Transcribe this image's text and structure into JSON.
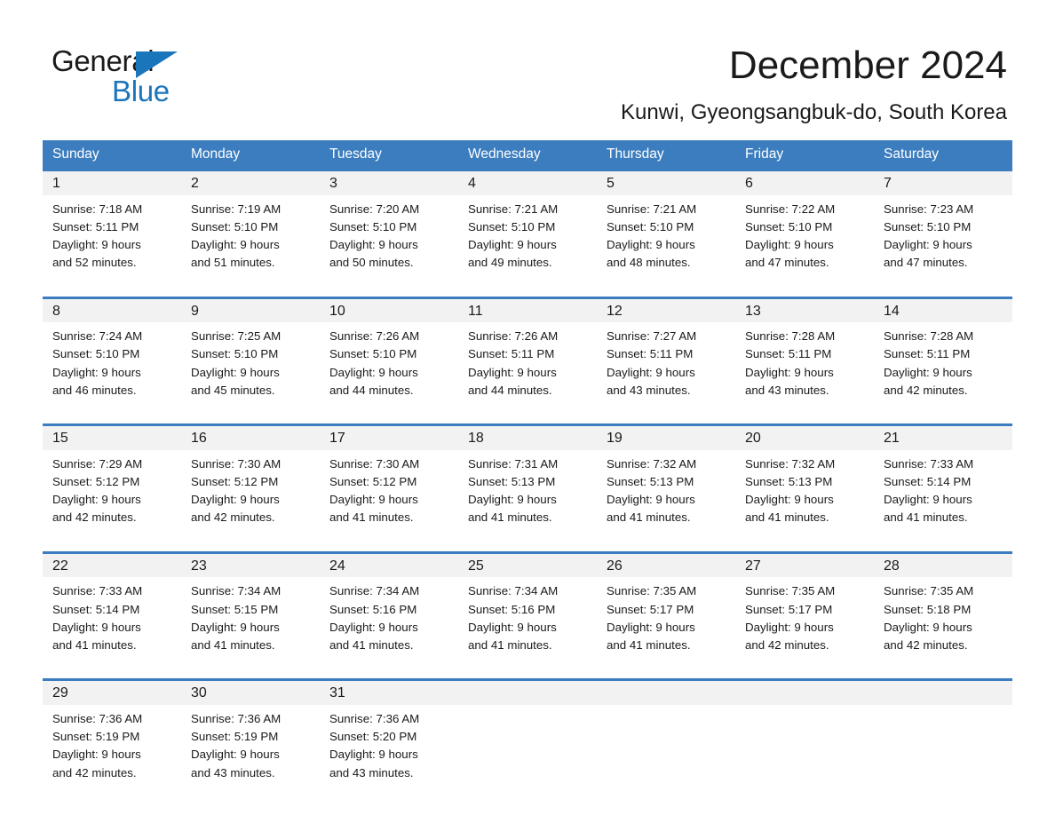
{
  "brand": {
    "name_part1": "General",
    "name_part2": "Blue",
    "triangle_icon": "triangle-icon",
    "accent_color": "#1b75bb"
  },
  "header": {
    "title": "December 2024",
    "location": "Kunwi, Gyeongsangbuk-do, South Korea"
  },
  "theme": {
    "header_row_bg": "#3b7dbf",
    "date_row_bg": "#f2f2f2",
    "cell_bg": "#ffffff",
    "text_color": "#1a1a1a"
  },
  "weekdays": [
    "Sunday",
    "Monday",
    "Tuesday",
    "Wednesday",
    "Thursday",
    "Friday",
    "Saturday"
  ],
  "weeks": [
    {
      "days": [
        {
          "date": "1",
          "sunrise": "Sunrise: 7:18 AM",
          "sunset": "Sunset: 5:11 PM",
          "daylight_1": "Daylight: 9 hours",
          "daylight_2": "and 52 minutes."
        },
        {
          "date": "2",
          "sunrise": "Sunrise: 7:19 AM",
          "sunset": "Sunset: 5:10 PM",
          "daylight_1": "Daylight: 9 hours",
          "daylight_2": "and 51 minutes."
        },
        {
          "date": "3",
          "sunrise": "Sunrise: 7:20 AM",
          "sunset": "Sunset: 5:10 PM",
          "daylight_1": "Daylight: 9 hours",
          "daylight_2": "and 50 minutes."
        },
        {
          "date": "4",
          "sunrise": "Sunrise: 7:21 AM",
          "sunset": "Sunset: 5:10 PM",
          "daylight_1": "Daylight: 9 hours",
          "daylight_2": "and 49 minutes."
        },
        {
          "date": "5",
          "sunrise": "Sunrise: 7:21 AM",
          "sunset": "Sunset: 5:10 PM",
          "daylight_1": "Daylight: 9 hours",
          "daylight_2": "and 48 minutes."
        },
        {
          "date": "6",
          "sunrise": "Sunrise: 7:22 AM",
          "sunset": "Sunset: 5:10 PM",
          "daylight_1": "Daylight: 9 hours",
          "daylight_2": "and 47 minutes."
        },
        {
          "date": "7",
          "sunrise": "Sunrise: 7:23 AM",
          "sunset": "Sunset: 5:10 PM",
          "daylight_1": "Daylight: 9 hours",
          "daylight_2": "and 47 minutes."
        }
      ]
    },
    {
      "days": [
        {
          "date": "8",
          "sunrise": "Sunrise: 7:24 AM",
          "sunset": "Sunset: 5:10 PM",
          "daylight_1": "Daylight: 9 hours",
          "daylight_2": "and 46 minutes."
        },
        {
          "date": "9",
          "sunrise": "Sunrise: 7:25 AM",
          "sunset": "Sunset: 5:10 PM",
          "daylight_1": "Daylight: 9 hours",
          "daylight_2": "and 45 minutes."
        },
        {
          "date": "10",
          "sunrise": "Sunrise: 7:26 AM",
          "sunset": "Sunset: 5:10 PM",
          "daylight_1": "Daylight: 9 hours",
          "daylight_2": "and 44 minutes."
        },
        {
          "date": "11",
          "sunrise": "Sunrise: 7:26 AM",
          "sunset": "Sunset: 5:11 PM",
          "daylight_1": "Daylight: 9 hours",
          "daylight_2": "and 44 minutes."
        },
        {
          "date": "12",
          "sunrise": "Sunrise: 7:27 AM",
          "sunset": "Sunset: 5:11 PM",
          "daylight_1": "Daylight: 9 hours",
          "daylight_2": "and 43 minutes."
        },
        {
          "date": "13",
          "sunrise": "Sunrise: 7:28 AM",
          "sunset": "Sunset: 5:11 PM",
          "daylight_1": "Daylight: 9 hours",
          "daylight_2": "and 43 minutes."
        },
        {
          "date": "14",
          "sunrise": "Sunrise: 7:28 AM",
          "sunset": "Sunset: 5:11 PM",
          "daylight_1": "Daylight: 9 hours",
          "daylight_2": "and 42 minutes."
        }
      ]
    },
    {
      "days": [
        {
          "date": "15",
          "sunrise": "Sunrise: 7:29 AM",
          "sunset": "Sunset: 5:12 PM",
          "daylight_1": "Daylight: 9 hours",
          "daylight_2": "and 42 minutes."
        },
        {
          "date": "16",
          "sunrise": "Sunrise: 7:30 AM",
          "sunset": "Sunset: 5:12 PM",
          "daylight_1": "Daylight: 9 hours",
          "daylight_2": "and 42 minutes."
        },
        {
          "date": "17",
          "sunrise": "Sunrise: 7:30 AM",
          "sunset": "Sunset: 5:12 PM",
          "daylight_1": "Daylight: 9 hours",
          "daylight_2": "and 41 minutes."
        },
        {
          "date": "18",
          "sunrise": "Sunrise: 7:31 AM",
          "sunset": "Sunset: 5:13 PM",
          "daylight_1": "Daylight: 9 hours",
          "daylight_2": "and 41 minutes."
        },
        {
          "date": "19",
          "sunrise": "Sunrise: 7:32 AM",
          "sunset": "Sunset: 5:13 PM",
          "daylight_1": "Daylight: 9 hours",
          "daylight_2": "and 41 minutes."
        },
        {
          "date": "20",
          "sunrise": "Sunrise: 7:32 AM",
          "sunset": "Sunset: 5:13 PM",
          "daylight_1": "Daylight: 9 hours",
          "daylight_2": "and 41 minutes."
        },
        {
          "date": "21",
          "sunrise": "Sunrise: 7:33 AM",
          "sunset": "Sunset: 5:14 PM",
          "daylight_1": "Daylight: 9 hours",
          "daylight_2": "and 41 minutes."
        }
      ]
    },
    {
      "days": [
        {
          "date": "22",
          "sunrise": "Sunrise: 7:33 AM",
          "sunset": "Sunset: 5:14 PM",
          "daylight_1": "Daylight: 9 hours",
          "daylight_2": "and 41 minutes."
        },
        {
          "date": "23",
          "sunrise": "Sunrise: 7:34 AM",
          "sunset": "Sunset: 5:15 PM",
          "daylight_1": "Daylight: 9 hours",
          "daylight_2": "and 41 minutes."
        },
        {
          "date": "24",
          "sunrise": "Sunrise: 7:34 AM",
          "sunset": "Sunset: 5:16 PM",
          "daylight_1": "Daylight: 9 hours",
          "daylight_2": "and 41 minutes."
        },
        {
          "date": "25",
          "sunrise": "Sunrise: 7:34 AM",
          "sunset": "Sunset: 5:16 PM",
          "daylight_1": "Daylight: 9 hours",
          "daylight_2": "and 41 minutes."
        },
        {
          "date": "26",
          "sunrise": "Sunrise: 7:35 AM",
          "sunset": "Sunset: 5:17 PM",
          "daylight_1": "Daylight: 9 hours",
          "daylight_2": "and 41 minutes."
        },
        {
          "date": "27",
          "sunrise": "Sunrise: 7:35 AM",
          "sunset": "Sunset: 5:17 PM",
          "daylight_1": "Daylight: 9 hours",
          "daylight_2": "and 42 minutes."
        },
        {
          "date": "28",
          "sunrise": "Sunrise: 7:35 AM",
          "sunset": "Sunset: 5:18 PM",
          "daylight_1": "Daylight: 9 hours",
          "daylight_2": "and 42 minutes."
        }
      ]
    },
    {
      "days": [
        {
          "date": "29",
          "sunrise": "Sunrise: 7:36 AM",
          "sunset": "Sunset: 5:19 PM",
          "daylight_1": "Daylight: 9 hours",
          "daylight_2": "and 42 minutes."
        },
        {
          "date": "30",
          "sunrise": "Sunrise: 7:36 AM",
          "sunset": "Sunset: 5:19 PM",
          "daylight_1": "Daylight: 9 hours",
          "daylight_2": "and 43 minutes."
        },
        {
          "date": "31",
          "sunrise": "Sunrise: 7:36 AM",
          "sunset": "Sunset: 5:20 PM",
          "daylight_1": "Daylight: 9 hours",
          "daylight_2": "and 43 minutes."
        },
        {
          "date": "",
          "sunrise": "",
          "sunset": "",
          "daylight_1": "",
          "daylight_2": ""
        },
        {
          "date": "",
          "sunrise": "",
          "sunset": "",
          "daylight_1": "",
          "daylight_2": ""
        },
        {
          "date": "",
          "sunrise": "",
          "sunset": "",
          "daylight_1": "",
          "daylight_2": ""
        },
        {
          "date": "",
          "sunrise": "",
          "sunset": "",
          "daylight_1": "",
          "daylight_2": ""
        }
      ]
    }
  ]
}
